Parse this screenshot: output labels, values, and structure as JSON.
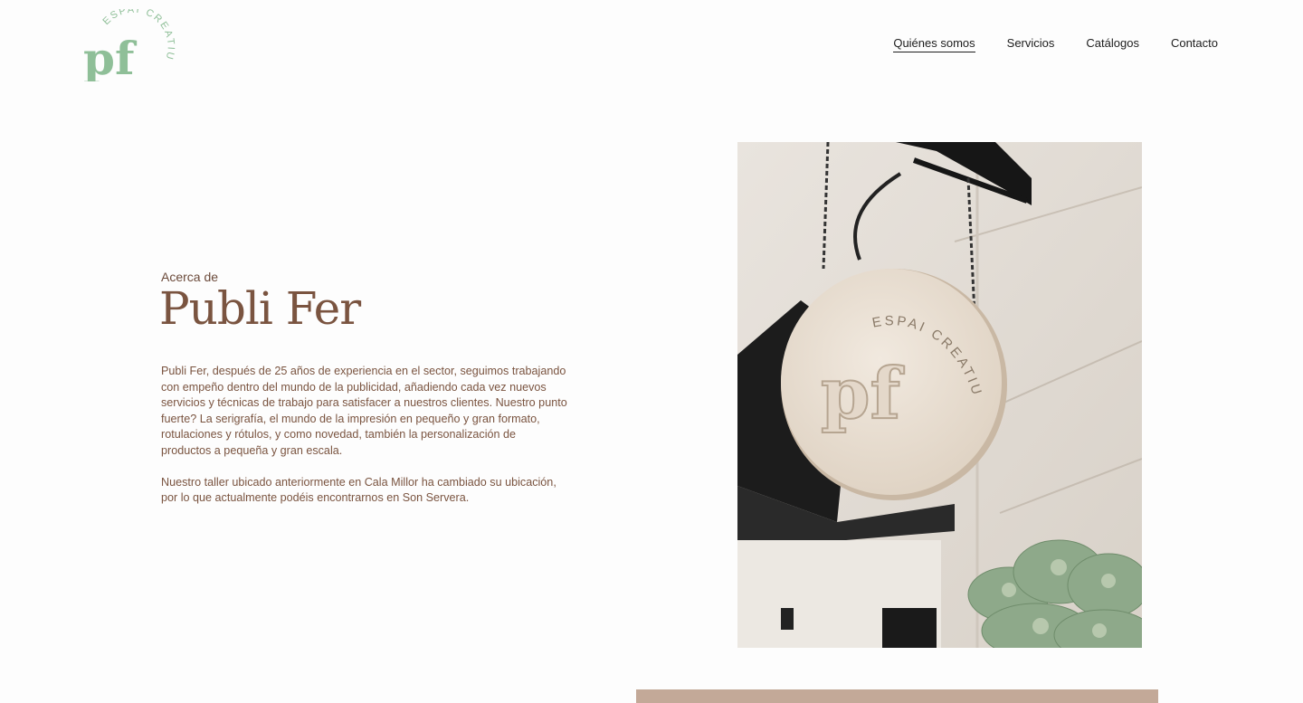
{
  "logo": {
    "mark": "pf",
    "tagline": "ESPAI CREATIU"
  },
  "nav": {
    "items": [
      {
        "label": "Quiénes somos",
        "active": true
      },
      {
        "label": "Servicios",
        "active": false
      },
      {
        "label": "Catálogos",
        "active": false
      },
      {
        "label": "Contacto",
        "active": false
      }
    ]
  },
  "about": {
    "eyebrow": "Acerca de",
    "title": "Publi Fer",
    "paragraphs": [
      "Publi Fer, después de 25 años de experiencia en el sector, seguimos trabajando con empeño dentro del mundo de la publicidad, añadiendo cada vez nuevos servicios y técnicas de trabajo para satisfacer a nuestros clientes. Nuestro punto fuerte? La serigrafía, el mundo de la impresión en pequeño y gran formato, rotulaciones y rótulos, y como novedad, también la personalización de productos a pequeña y gran escala.",
      "Nuestro taller ubicado anteriormente en Cala Millor ha cambiado su ubicación, por lo que actualmente podéis encontrarnos en Son Servera."
    ]
  },
  "photo": {
    "sign_mark": "pf",
    "sign_tagline": "ESPAI CREATIU"
  },
  "colors": {
    "brand_green": "#8fbf98",
    "brown_text": "#7a5440",
    "band": "#c3a998"
  }
}
